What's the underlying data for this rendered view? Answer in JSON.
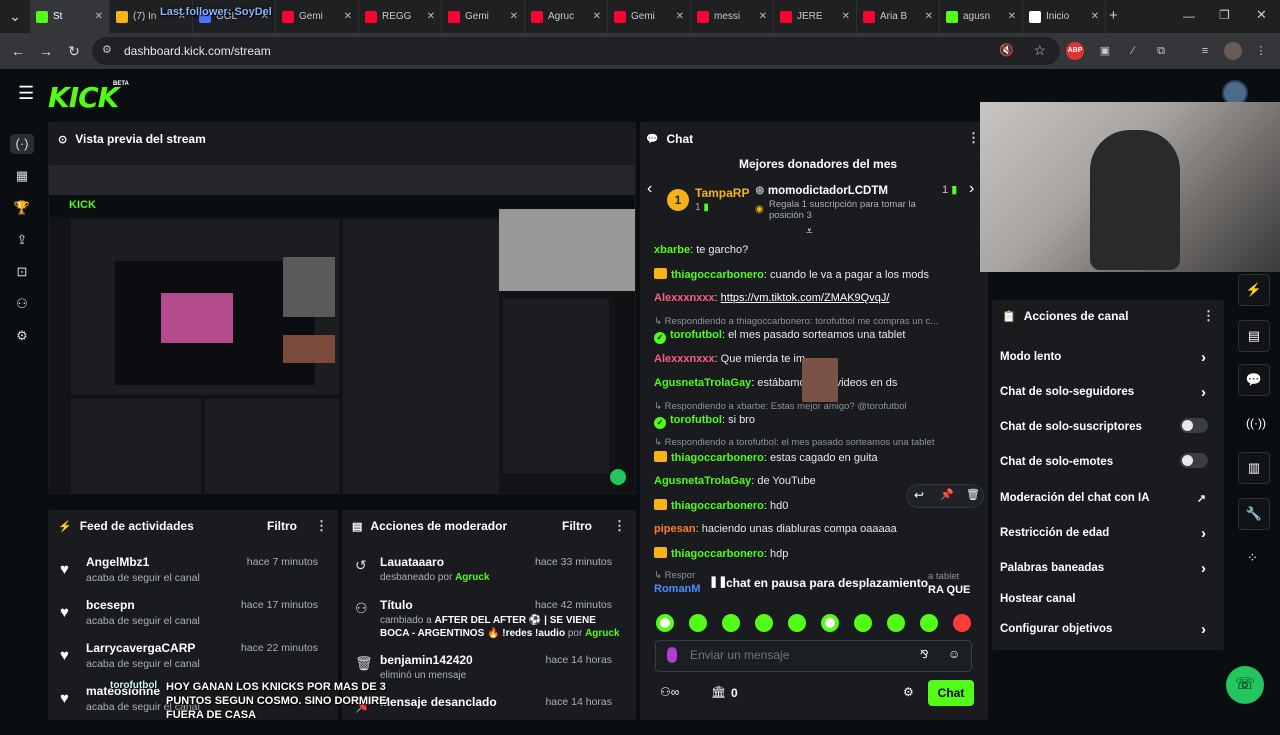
{
  "browser": {
    "tabs": [
      {
        "title": "St",
        "color": "#53fc18"
      },
      {
        "title": "(7) In",
        "color": "#f5b316"
      },
      {
        "title": "GOL",
        "color": "#4a73ff"
      },
      {
        "title": "Gemi",
        "color": "#ff0033"
      },
      {
        "title": "REGG",
        "color": "#ff0033"
      },
      {
        "title": "Gemi",
        "color": "#ff0033"
      },
      {
        "title": "Agruc",
        "color": "#ff0033"
      },
      {
        "title": "Gemi",
        "color": "#ff0033"
      },
      {
        "title": "messi",
        "color": "#ff0033"
      },
      {
        "title": "JERE",
        "color": "#ff0033"
      },
      {
        "title": "Aria B",
        "color": "#ff0033"
      },
      {
        "title": "agusn",
        "color": "#53fc18"
      },
      {
        "title": "Inicio",
        "color": "#ffffff"
      }
    ],
    "overlay_text": "Last follower: SoyDel",
    "url": "dashboard.kick.com/stream"
  },
  "kick": {
    "logo": "KICK",
    "beta": "BETA"
  },
  "preview": {
    "title": "Vista previa del stream"
  },
  "feed": {
    "title": "Feed de actividades",
    "filter": "Filtro",
    "items": [
      {
        "name": "AngelMbz1",
        "sub": "acaba de seguir el canal",
        "time": "hace 7 minutos"
      },
      {
        "name": "bcesepn",
        "sub": "acaba de seguir el canal",
        "time": "hace 17 minutos"
      },
      {
        "name": "LarrycavergaCARP",
        "sub": "acaba de seguir el canal",
        "time": "hace 22 minutos"
      },
      {
        "name": "mateosionne",
        "sub": "acaba de seguir el canal",
        "time": ""
      }
    ]
  },
  "mod": {
    "title": "Acciones de moderador",
    "filter": "Filtro",
    "items": [
      {
        "icon": "undo-icon",
        "name": "Lauataaaro",
        "sub_pre": "desbaneado por ",
        "sub_by": "Agruck",
        "time": "hace 33 minutos"
      },
      {
        "icon": "users-icon",
        "name": "Título",
        "sub_pre": "cambiado a ",
        "sub_bold": "AFTER DEL AFTER ⚽ | SE VIENE BOCA - ARGENTINOS 🔥 !redes !audio",
        "sub_mid": " por ",
        "sub_by": "Agruck",
        "time": "hace 42 minutos"
      },
      {
        "icon": "trash-icon",
        "name": "benjamin142420",
        "sub_pre": "eliminó un mensaje",
        "time": "hace 14 horas"
      },
      {
        "icon": "pin-icon",
        "name": "Mensaje desanclado",
        "time": "hace 14 horas"
      }
    ]
  },
  "caption": {
    "label": "torofutbol",
    "text": "HOY GANAN LOS KNICKS POR MAS DE 3 PUNTOS SEGUN COSMO. SINO DORMIRE FUERA DE CASA"
  },
  "chat": {
    "title": "Chat",
    "donors_title": "Mejores donadores del mes",
    "donor1": {
      "rank": "1",
      "name": "TampaRP",
      "count": "1"
    },
    "donor2": {
      "name": "momodictadorLCDTM",
      "count": "1",
      "hint": "Regala 1 suscripción para tomar la posición 3"
    },
    "messages": [
      {
        "user": "xbarbe",
        "color": "#53fc18",
        "text": "te garcho?"
      },
      {
        "user": "thiagoccarbonero",
        "color": "#53fc18",
        "text": "cuando le va a pagar a los mods",
        "badge": "crown"
      },
      {
        "user": "Alexxxnxxx",
        "color": "#ff5c8a",
        "text": "https://vm.tiktok.com/ZMAK9QvqJ/",
        "link": true
      },
      {
        "reply": "Respondiendo a thiagoccarbonero: torofutbol me compras un c..."
      },
      {
        "user": "torofutbol",
        "color": "#53fc18",
        "text": "el mes pasado sorteamos una tablet",
        "badge": "check"
      },
      {
        "user": "Alexxxnxxx",
        "color": "#ff5c8a",
        "text": "Que mierda te im"
      },
      {
        "user": "AgusnetaTrolaGay",
        "color": "#53fc18",
        "text": "estábamo         o tus videos en ds"
      },
      {
        "reply": "Respondiendo a xbarbe: Estas mejor amigo? @torofutbol"
      },
      {
        "user": "torofutbol",
        "color": "#53fc18",
        "text": "si bro",
        "badge": "check"
      },
      {
        "reply": "Respondiendo a torofutbol: el mes pasado sorteamos una tablet"
      },
      {
        "user": "thiagoccarbonero",
        "color": "#53fc18",
        "text": "estas cagado en guita",
        "badge": "crown"
      },
      {
        "user": "AgusnetaTrolaGay",
        "color": "#53fc18",
        "text": "de YouTube"
      },
      {
        "user": "thiagoccarbonero",
        "color": "#53fc18",
        "text": "hd0",
        "badge": "crown"
      },
      {
        "user": "pipesan",
        "color": "#ff7a2e",
        "text": "haciendo unas diabluras compa oaaaaa"
      },
      {
        "user": "thiagoccarbonero",
        "color": "#53fc18",
        "text": "hdp",
        "badge": "crown"
      },
      {
        "reply": "Respor"
      },
      {
        "user": "RomanM",
        "color": "#4a8cff",
        "text": ""
      }
    ],
    "paused": "chat en pausa para desplazamiento",
    "paused_tail1": "a tablet",
    "paused_tail2": "RA QUE",
    "input_placeholder": "Enviar un mensaje",
    "points": "0",
    "send": "Chat",
    "emote_colors": [
      "#53fc18",
      "#53fc18",
      "#53fc18",
      "#53fc18",
      "#53fc18",
      "#53fc18",
      "#53fc18",
      "#53fc18",
      "#53fc18",
      "#ff3b3b"
    ]
  },
  "channel": {
    "title": "Acciones de canal",
    "items": [
      {
        "label": "Modo lento",
        "control": "chevron"
      },
      {
        "label": "Chat de solo-seguidores",
        "control": "chevron"
      },
      {
        "label": "Chat de solo-suscriptores",
        "control": "toggle"
      },
      {
        "label": "Chat de solo-emotes",
        "control": "toggle"
      },
      {
        "label": "Moderación del chat con IA",
        "control": "external"
      },
      {
        "label": "Restricción de edad",
        "control": "chevron"
      },
      {
        "label": "Palabras baneadas",
        "control": "chevron"
      },
      {
        "label": "Hostear canal",
        "control": "none"
      },
      {
        "label": "Configurar objetivos",
        "control": "chevron"
      }
    ]
  }
}
